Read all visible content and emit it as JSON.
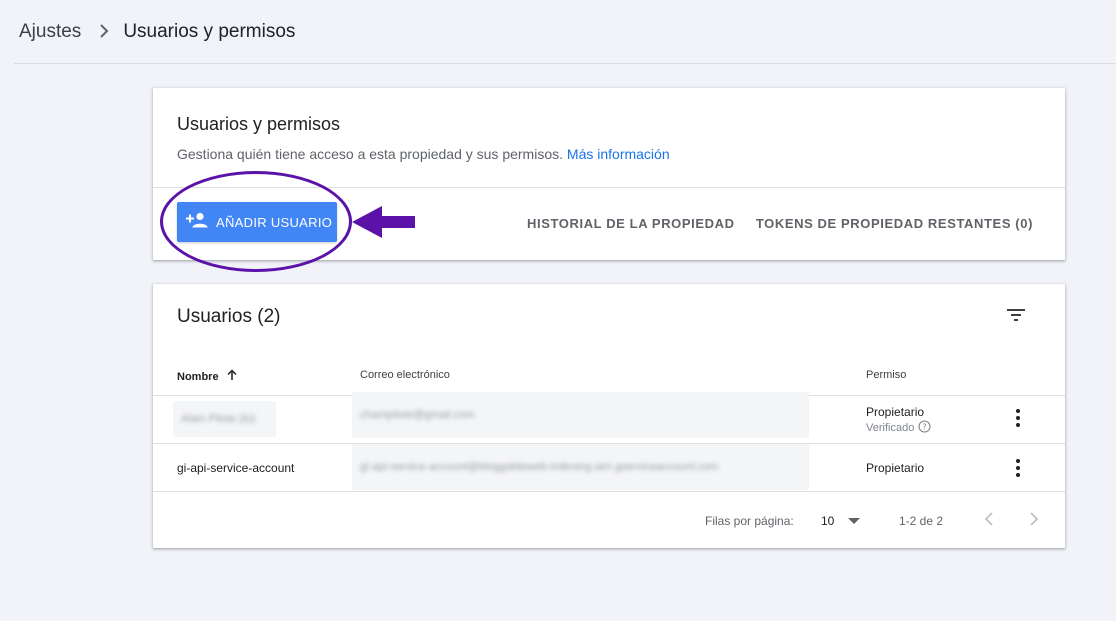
{
  "breadcrumb": {
    "root": "Ajustes",
    "separator": ">",
    "current": "Usuarios y permisos"
  },
  "header_card": {
    "title": "Usuarios y permisos",
    "description": "Gestiona quién tiene acceso a esta propiedad y sus permisos.",
    "link": "Más información",
    "add_user_label": "AÑADIR USUARIO",
    "history_label": "HISTORIAL DE LA PROPIEDAD",
    "tokens_label": "TOKENS DE PROPIEDAD RESTANTES (0)"
  },
  "users_card": {
    "title": "Usuarios (2)",
    "columns": {
      "name": "Nombre",
      "email": "Correo electrónico",
      "permission": "Permiso"
    },
    "rows": [
      {
        "name": "Alain Pilote (tú)",
        "email": "champilote@gmail.com",
        "permission": "Propietario",
        "status": "Verificado",
        "name_redacted": true,
        "email_redacted": true
      },
      {
        "name": "gi-api-service-account",
        "email": "gi-api-service-account@bloggableweb-indexing.iam.gserviceaccount.com",
        "permission": "Propietario",
        "name_redacted": false,
        "email_redacted": true
      }
    ],
    "footer": {
      "rows_label": "Filas por página:",
      "rows_value": "10",
      "range": "1-2 de 2"
    }
  },
  "colors": {
    "primary_button": "#4285f4",
    "link": "#1a73e8",
    "annotation": "#5b12a8",
    "background": "#f1f3f9"
  },
  "icons": [
    "chevron-right-icon",
    "person-add-icon",
    "filter-icon",
    "arrow-up-icon",
    "help-circle-icon",
    "more-vert-icon",
    "dropdown-caret-icon",
    "chevron-left-icon"
  ]
}
